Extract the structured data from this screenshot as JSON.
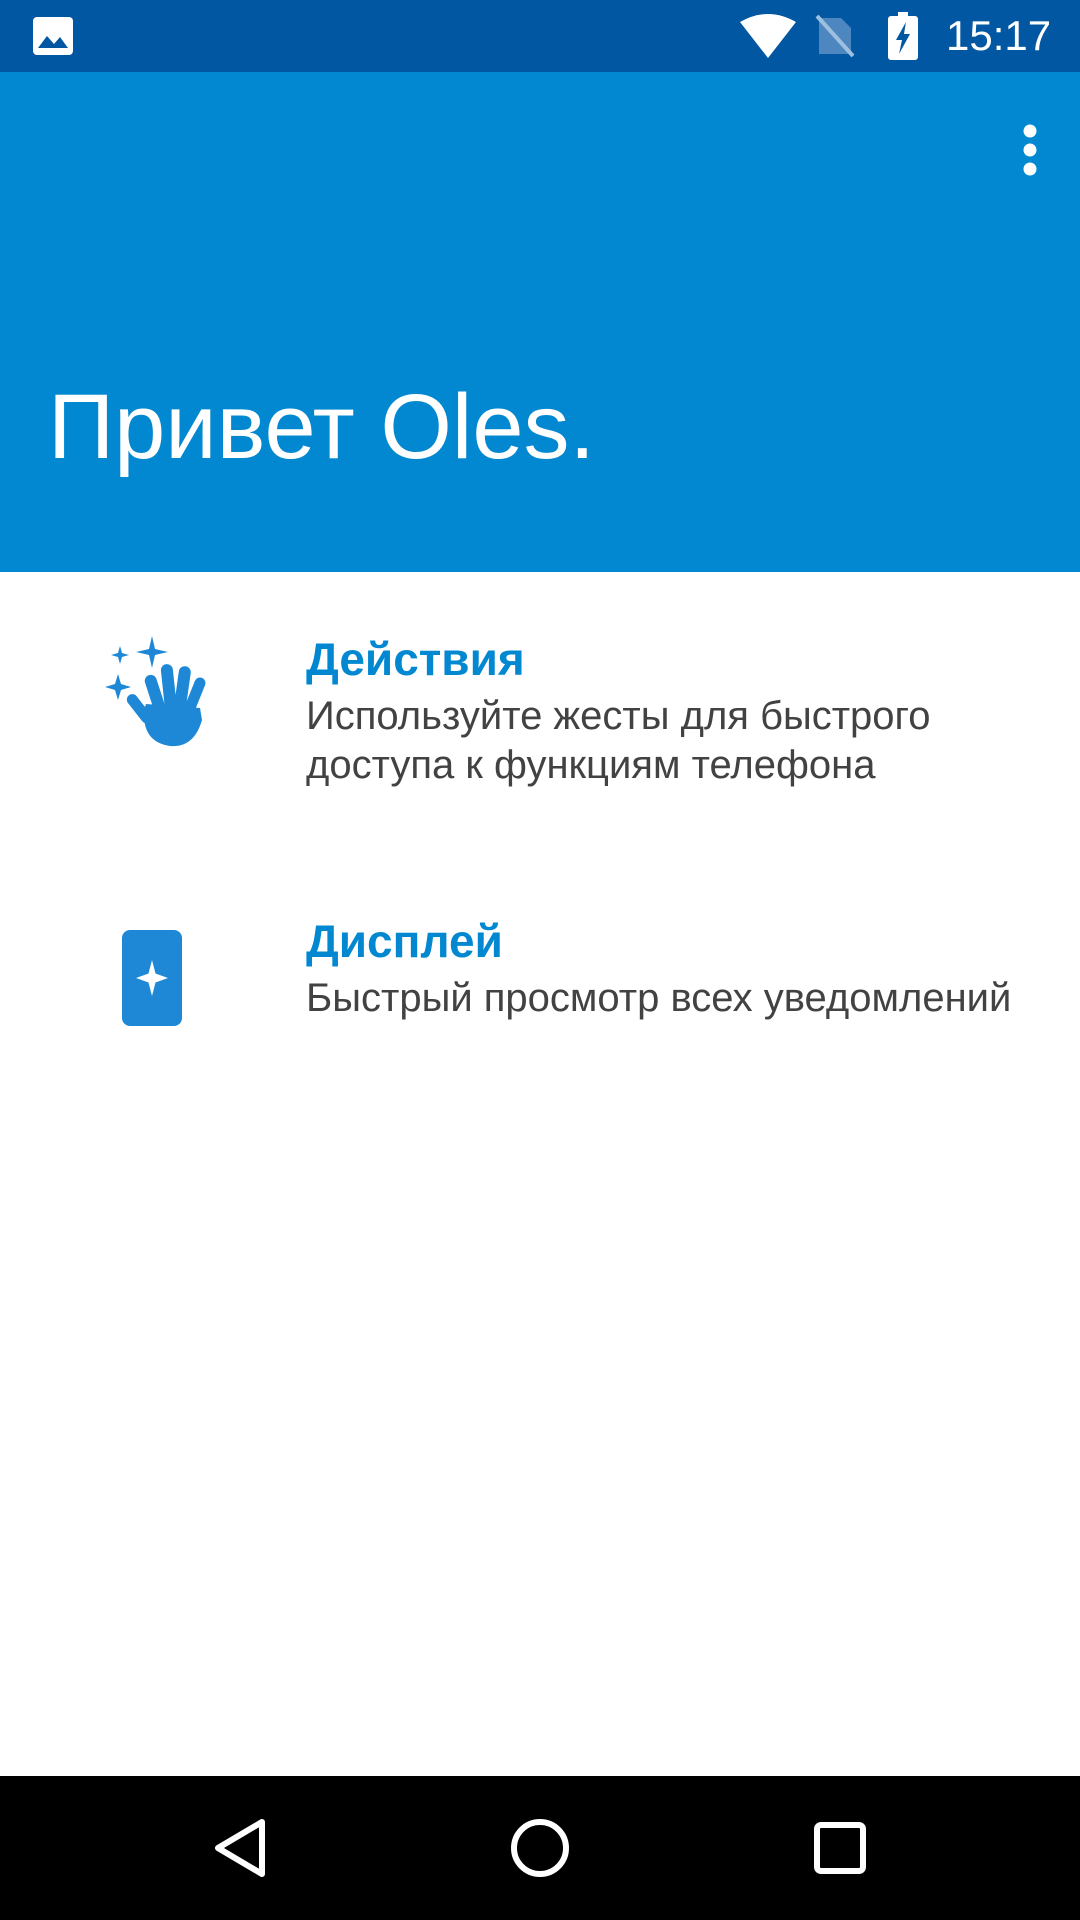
{
  "status_bar": {
    "time": "15:17",
    "icons": [
      "gallery-icon",
      "wifi-icon",
      "no-sim-icon",
      "battery-charging-icon"
    ]
  },
  "header": {
    "greeting": "Привет Oles.",
    "menu_icon": "more-vertical-icon"
  },
  "features": [
    {
      "icon": "hand-wave-sparkles-icon",
      "title": "Действия",
      "description": "Используйте жесты для быстрого доступа к функциям телефона"
    },
    {
      "icon": "phone-sparkle-icon",
      "title": "Дисплей",
      "description": "Быстрый просмотр всех уведомлений"
    }
  ],
  "nav_bar": {
    "buttons": [
      "back-icon",
      "home-icon",
      "recents-icon"
    ]
  },
  "colors": {
    "status_bar": "#0157a1",
    "header": "#0288d1",
    "accent": "#0288d1",
    "icon_blue": "#1e88d6",
    "body_text": "#424242",
    "nav_bar": "#000000"
  }
}
